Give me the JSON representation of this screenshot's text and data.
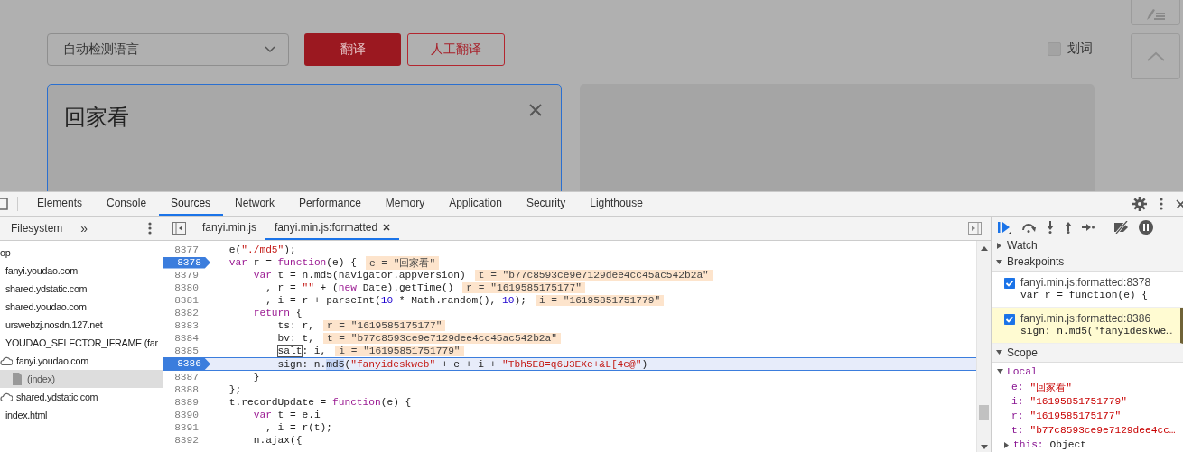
{
  "page": {
    "language_select": {
      "value": "自动检测语言"
    },
    "translate_button": "翻译",
    "human_translate_button": "人工翻译",
    "word_select": {
      "label": "划词",
      "checked": false
    },
    "input": {
      "value": "回家看"
    }
  },
  "devtools": {
    "tabs": [
      {
        "label": "Elements",
        "selected": false
      },
      {
        "label": "Console",
        "selected": false
      },
      {
        "label": "Sources",
        "selected": true
      },
      {
        "label": "Network",
        "selected": false
      },
      {
        "label": "Performance",
        "selected": false
      },
      {
        "label": "Memory",
        "selected": false
      },
      {
        "label": "Application",
        "selected": false
      },
      {
        "label": "Security",
        "selected": false
      },
      {
        "label": "Lighthouse",
        "selected": false
      }
    ],
    "navigator": {
      "label": "Filesystem",
      "more": "»",
      "tree": [
        {
          "label": "op",
          "selected": false,
          "children": [
            {
              "label": "fanyi.youdao.com",
              "selected": false
            },
            {
              "label": "shared.ydstatic.com",
              "selected": false
            },
            {
              "label": "shared.youdao.com",
              "selected": false
            },
            {
              "label": "urswebzj.nosdn.127.net",
              "selected": false
            },
            {
              "label": "YOUDAO_SELECTOR_IFRAME (far",
              "selected": false,
              "children": [
                {
                  "label": "fanyi.youdao.com",
                  "kind": "domain",
                  "selected": false,
                  "children": [
                    {
                      "label": "(index)",
                      "kind": "file",
                      "selected": true
                    }
                  ]
                },
                {
                  "label": "shared.ydstatic.com",
                  "kind": "domain",
                  "selected": false
                }
              ]
            },
            {
              "label": "index.html",
              "selected": false
            }
          ]
        }
      ]
    },
    "editor_tabs": [
      {
        "label": "fanyi.min.js",
        "selected": false,
        "closable": false
      },
      {
        "label": "fanyi.min.js:formatted",
        "selected": true,
        "closable": true
      }
    ],
    "code_lines": [
      {
        "number": "8377",
        "breakpoint": false,
        "current": false,
        "tokens": [
          {
            "kind": "text",
            "text": "    e("
          },
          {
            "kind": "str",
            "text": "\"./md5\""
          },
          {
            "kind": "text",
            "text": ");"
          }
        ]
      },
      {
        "number": "8378",
        "breakpoint": true,
        "current": false,
        "tokens": [
          {
            "kind": "kw",
            "text": "    var"
          },
          {
            "kind": "text",
            "text": " r = "
          },
          {
            "kind": "kw",
            "text": "function"
          },
          {
            "kind": "text",
            "text": "(e) {"
          }
        ],
        "inline_value": "e = \"回家看\""
      },
      {
        "number": "8379",
        "breakpoint": false,
        "current": false,
        "tokens": [
          {
            "kind": "kw",
            "text": "        var"
          },
          {
            "kind": "text",
            "text": " t = n.md5(navigator.appVersion)"
          }
        ],
        "inline_value": "t = \"b77c8593ce9e7129dee4cc45ac542b2a\""
      },
      {
        "number": "8380",
        "breakpoint": false,
        "current": false,
        "tokens": [
          {
            "kind": "text",
            "text": "          , r = "
          },
          {
            "kind": "str",
            "text": "\"\""
          },
          {
            "kind": "text",
            "text": " + ("
          },
          {
            "kind": "kw",
            "text": "new"
          },
          {
            "kind": "text",
            "text": " Date).getTime()"
          }
        ],
        "inline_value": "r = \"1619585175177\""
      },
      {
        "number": "8381",
        "breakpoint": false,
        "current": false,
        "tokens": [
          {
            "kind": "text",
            "text": "          , i = r + parseInt("
          },
          {
            "kind": "num",
            "text": "10"
          },
          {
            "kind": "text",
            "text": " * Math.random(), "
          },
          {
            "kind": "num",
            "text": "10"
          },
          {
            "kind": "text",
            "text": ");"
          }
        ],
        "inline_value": "i = \"16195851751779\""
      },
      {
        "number": "8382",
        "breakpoint": false,
        "current": false,
        "tokens": [
          {
            "kind": "kw",
            "text": "        return"
          },
          {
            "kind": "text",
            "text": " {"
          }
        ]
      },
      {
        "number": "8383",
        "breakpoint": false,
        "current": false,
        "tokens": [
          {
            "kind": "text",
            "text": "            ts: r,"
          }
        ],
        "inline_value": "r = \"1619585175177\""
      },
      {
        "number": "8384",
        "breakpoint": false,
        "current": false,
        "tokens": [
          {
            "kind": "text",
            "text": "            bv: t,"
          }
        ],
        "inline_value": "t = \"b77c8593ce9e7129dee4cc45ac542b2a\""
      },
      {
        "number": "8385",
        "breakpoint": false,
        "current": false,
        "tokens": [
          {
            "kind": "boxed",
            "text": "            salt"
          },
          {
            "kind": "text",
            "text": ": i,"
          }
        ],
        "inline_value": "i = \"16195851751779\""
      },
      {
        "number": "8386",
        "breakpoint": true,
        "current": true,
        "tokens": [
          {
            "kind": "text",
            "text": "            sign: n."
          },
          {
            "kind": "selection",
            "text": "md5"
          },
          {
            "kind": "text",
            "text": "("
          },
          {
            "kind": "str",
            "text": "\"fanyideskweb\""
          },
          {
            "kind": "text",
            "text": " + e + i + "
          },
          {
            "kind": "str",
            "text": "\"Tbh5E8=q6U3EXe+&L[4c@\""
          },
          {
            "kind": "text",
            "text": ")"
          }
        ]
      },
      {
        "number": "8387",
        "breakpoint": false,
        "current": false,
        "tokens": [
          {
            "kind": "text",
            "text": "        }"
          }
        ]
      },
      {
        "number": "8388",
        "breakpoint": false,
        "current": false,
        "tokens": [
          {
            "kind": "text",
            "text": "    };"
          }
        ]
      },
      {
        "number": "8389",
        "breakpoint": false,
        "current": false,
        "tokens": [
          {
            "kind": "text",
            "text": "    t.recordUpdate = "
          },
          {
            "kind": "kw",
            "text": "function"
          },
          {
            "kind": "text",
            "text": "(e) {"
          }
        ]
      },
      {
        "number": "8390",
        "breakpoint": false,
        "current": false,
        "tokens": [
          {
            "kind": "kw",
            "text": "        var"
          },
          {
            "kind": "text",
            "text": " t = e.i"
          }
        ]
      },
      {
        "number": "8391",
        "breakpoint": false,
        "current": false,
        "tokens": [
          {
            "kind": "text",
            "text": "          , i = r(t);"
          }
        ]
      },
      {
        "number": "8392",
        "breakpoint": false,
        "current": false,
        "tokens": [
          {
            "kind": "text",
            "text": "        n.ajax({"
          }
        ]
      }
    ],
    "debugger": {
      "watch": {
        "title": "Watch",
        "expanded": false
      },
      "breakpoints": {
        "title": "Breakpoints",
        "expanded": true,
        "items": [
          {
            "location": "fanyi.min.js:formatted:8378",
            "code": "var r = function(e) {",
            "checked": true,
            "hit": false
          },
          {
            "location": "fanyi.min.js:formatted:8386",
            "code": "sign: n.md5(\"fanyideskwe…",
            "checked": true,
            "hit": true
          }
        ]
      },
      "scope": {
        "title": "Scope",
        "expanded": true,
        "groups": [
          {
            "title": "Local",
            "expanded": true,
            "vars": [
              {
                "name": "e:",
                "value": "\"回家看\"",
                "expandable": false
              },
              {
                "name": "i:",
                "value": "\"16195851751779\"",
                "expandable": false
              },
              {
                "name": "r:",
                "value": "\"1619585175177\"",
                "expandable": false
              },
              {
                "name": "t:",
                "value": "\"b77c8593ce9e7129dee4cc…",
                "expandable": false
              },
              {
                "name": "this:",
                "value": "Object",
                "expandable": true
              }
            ]
          }
        ]
      }
    }
  }
}
